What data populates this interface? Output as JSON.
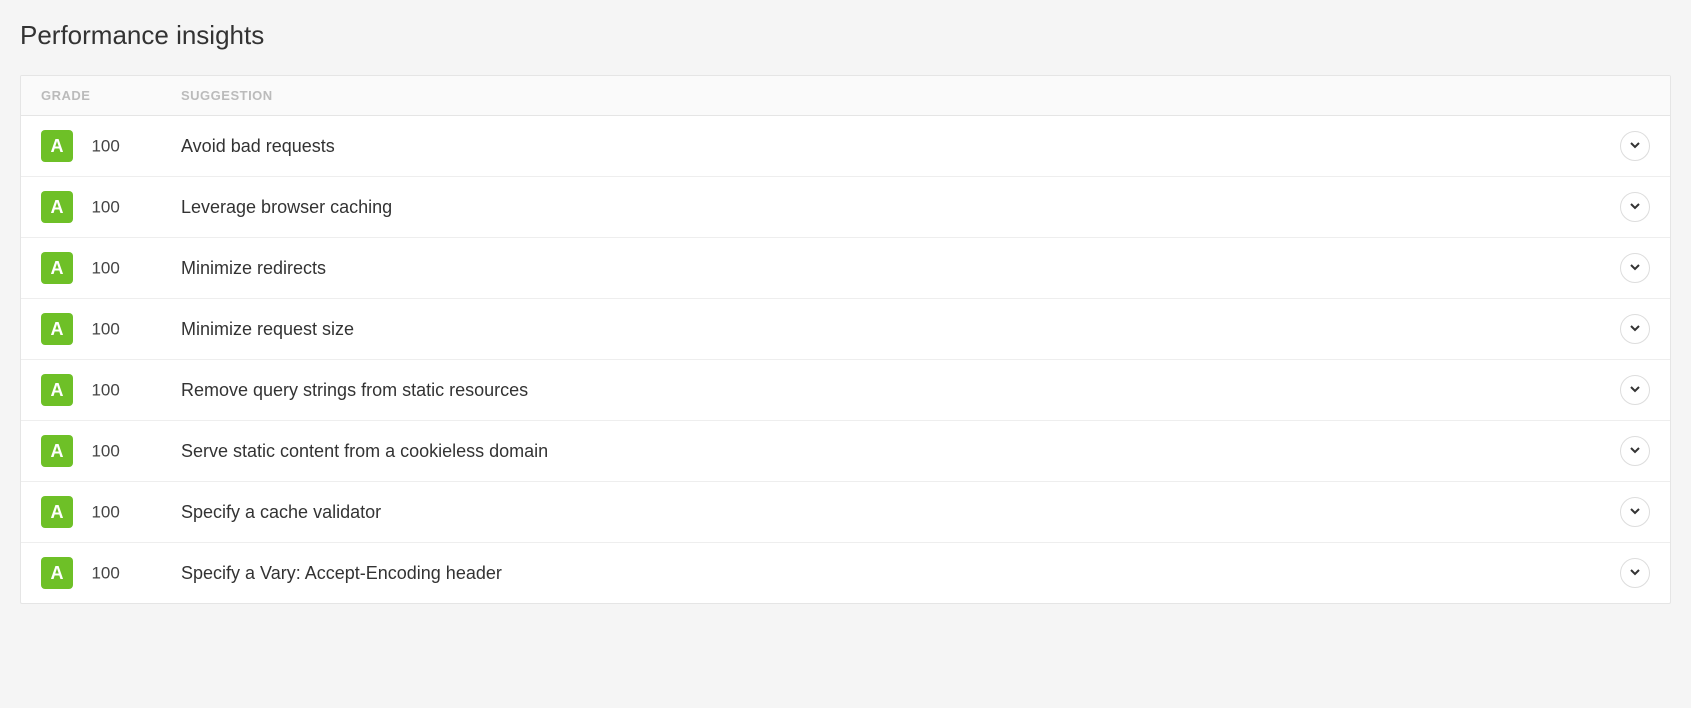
{
  "title": "Performance insights",
  "headers": {
    "grade": "GRADE",
    "suggestion": "SUGGESTION"
  },
  "rows": [
    {
      "grade_letter": "A",
      "score": "100",
      "suggestion": "Avoid bad requests"
    },
    {
      "grade_letter": "A",
      "score": "100",
      "suggestion": "Leverage browser caching"
    },
    {
      "grade_letter": "A",
      "score": "100",
      "suggestion": "Minimize redirects"
    },
    {
      "grade_letter": "A",
      "score": "100",
      "suggestion": "Minimize request size"
    },
    {
      "grade_letter": "A",
      "score": "100",
      "suggestion": "Remove query strings from static resources"
    },
    {
      "grade_letter": "A",
      "score": "100",
      "suggestion": "Serve static content from a cookieless domain"
    },
    {
      "grade_letter": "A",
      "score": "100",
      "suggestion": "Specify a cache validator"
    },
    {
      "grade_letter": "A",
      "score": "100",
      "suggestion": "Specify a Vary: Accept-Encoding header"
    }
  ]
}
